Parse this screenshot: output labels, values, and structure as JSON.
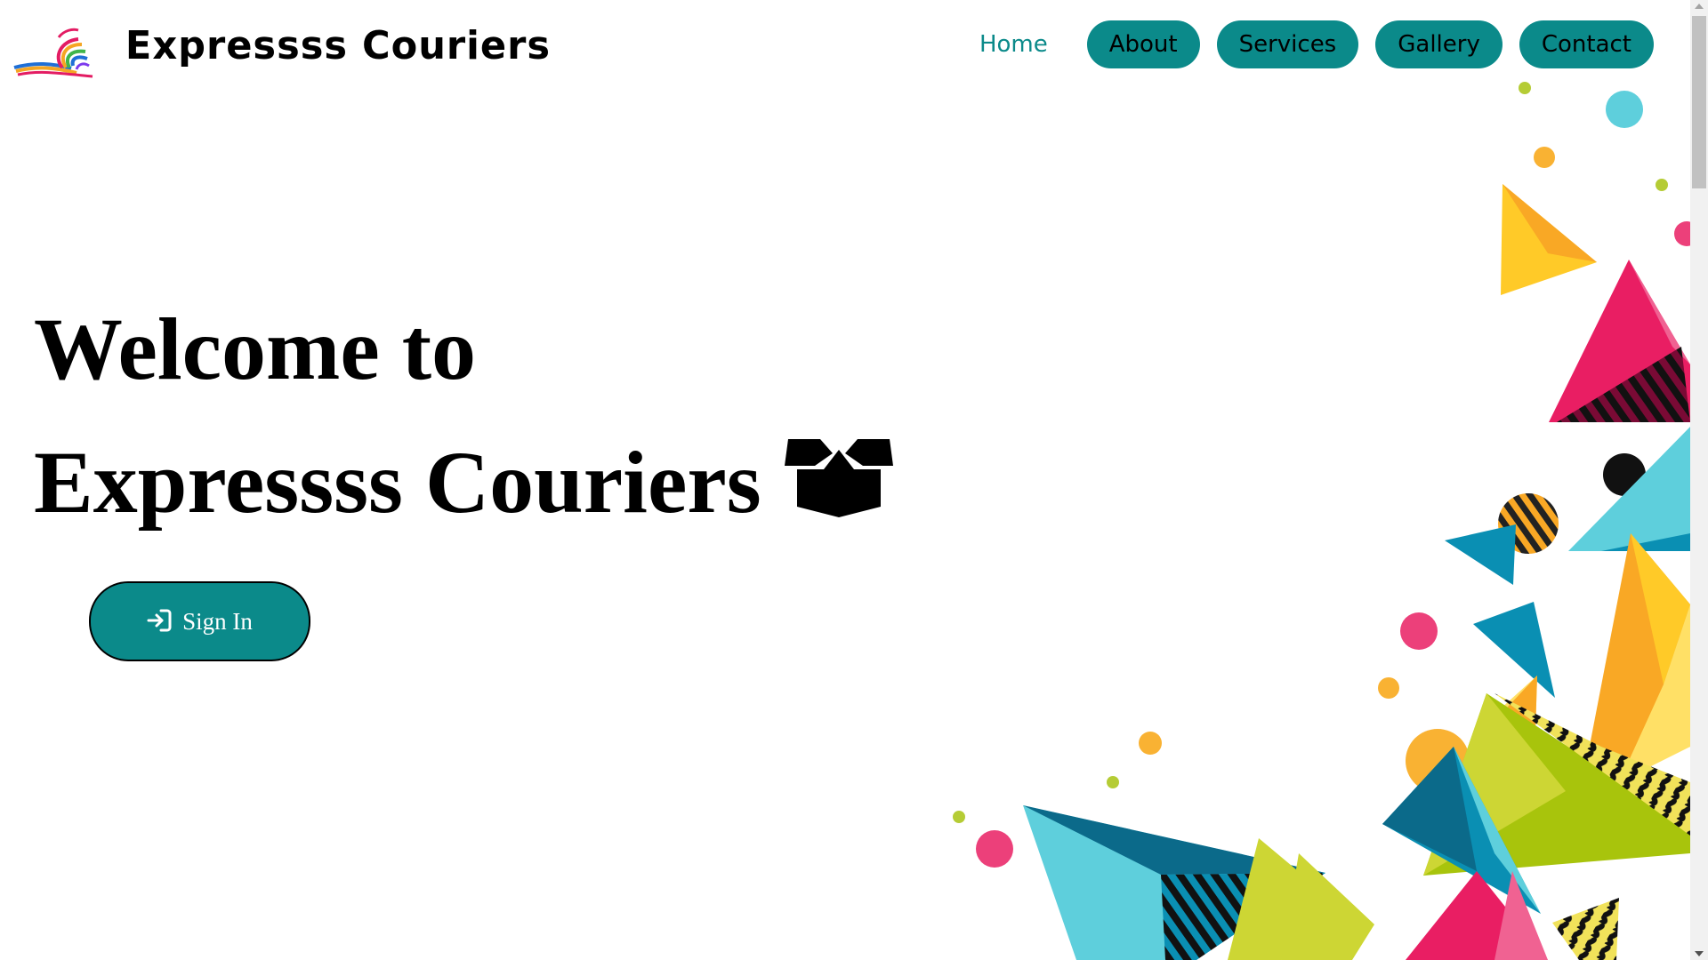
{
  "brand": {
    "name": "Expressss Couriers",
    "logo_icon": "swoosh-logo-icon"
  },
  "nav": {
    "items": [
      {
        "label": "Home",
        "active": true
      },
      {
        "label": "About",
        "active": false
      },
      {
        "label": "Services",
        "active": false
      },
      {
        "label": "Gallery",
        "active": false
      },
      {
        "label": "Contact",
        "active": false
      }
    ]
  },
  "hero": {
    "line1": "Welcome to",
    "line2": "Expressss Couriers",
    "box_icon": "box-open-icon",
    "signin_label": "Sign In",
    "signin_icon": "sign-in-icon"
  },
  "colors": {
    "accent": "#0b8a8a",
    "background": "#ffffff",
    "text": "#000000"
  }
}
